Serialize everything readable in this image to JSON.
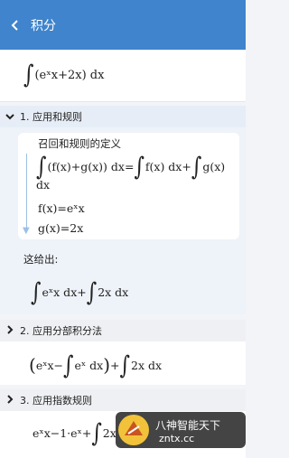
{
  "header": {
    "title": "积分",
    "back_icon": "‹"
  },
  "problem": {
    "expression": "(eˣx+2x) dx"
  },
  "steps": [
    {
      "label": "1. 应用和规则",
      "expanded": true
    },
    {
      "label": "2. 应用分部积分法",
      "expanded": false
    },
    {
      "label": "3. 应用指数规则",
      "expanded": false
    }
  ],
  "step1": {
    "recall": "召回和规则的定义",
    "rule_a": "(f(x)+g(x)) dx=",
    "rule_b": "f(x) dx+",
    "rule_c": "g(x)",
    "rule_tail": "dx",
    "f_def": "f(x)=eˣx",
    "g_def": "g(x)=2x",
    "gives": "这给出:",
    "result_a": "eˣx dx+",
    "result_b": "2x dx"
  },
  "step2": {
    "result_a": "eˣx−",
    "result_b": "eˣ dx",
    "result_c": "+",
    "result_d": "2x dx"
  },
  "step3": {
    "result_a": "eˣx−1·eˣ+",
    "result_b": "2x dx"
  },
  "watermark": {
    "text": "八神智能天下",
    "url": "zntx.cc"
  }
}
